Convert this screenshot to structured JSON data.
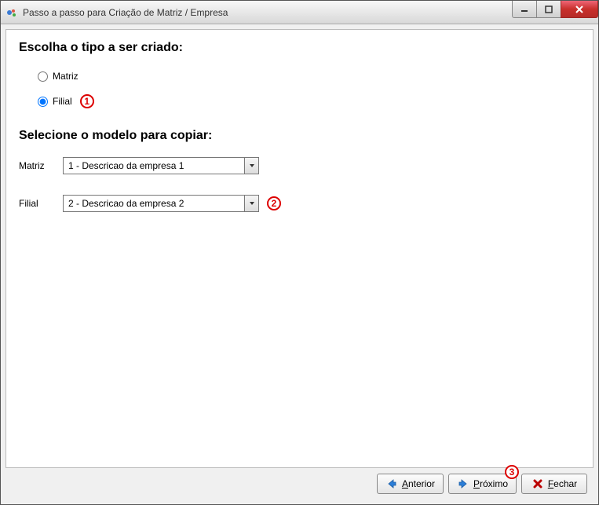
{
  "window": {
    "title": "Passo a passo para Criação de Matriz / Empresa"
  },
  "headings": {
    "type_heading": "Escolha o tipo a ser criado:",
    "model_heading": "Selecione o modelo para copiar:"
  },
  "radios": {
    "matriz_label": "Matriz",
    "filial_label": "Filial",
    "selected": "filial"
  },
  "callouts": {
    "c1": "1",
    "c2": "2",
    "c3": "3"
  },
  "form": {
    "matriz_label": "Matriz",
    "filial_label": "Filial",
    "matriz_value": "1 - Descricao da empresa 1",
    "filial_value": "2 - Descricao da empresa 2"
  },
  "buttons": {
    "anterior_prefix": "A",
    "anterior_rest": "nterior",
    "proximo_prefix": "P",
    "proximo_rest": "róximo",
    "fechar_prefix": "F",
    "fechar_rest": "echar"
  }
}
